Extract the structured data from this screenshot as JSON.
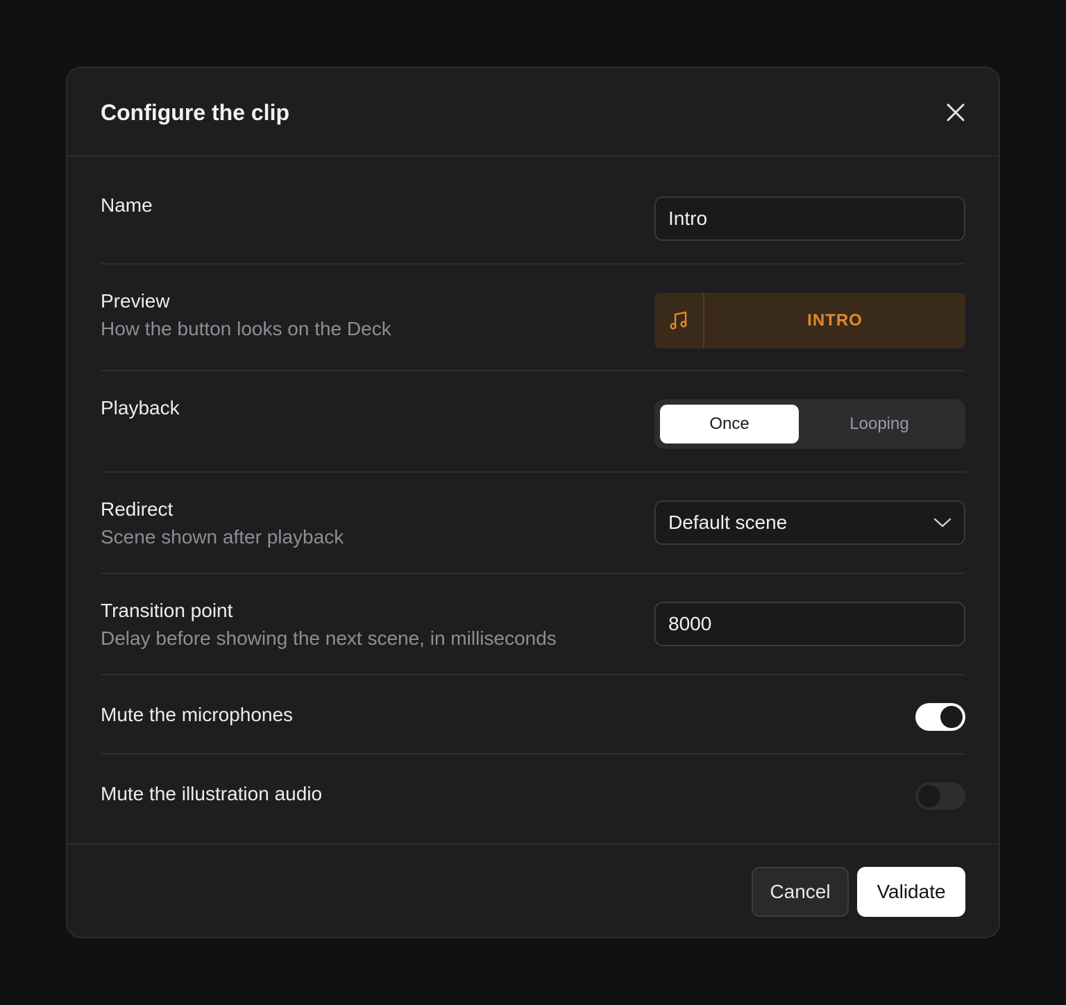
{
  "dialog": {
    "title": "Configure the clip",
    "close_icon": "close-icon"
  },
  "fields": {
    "name": {
      "label": "Name",
      "value": "Intro"
    },
    "preview": {
      "label": "Preview",
      "description": "How the button looks on the Deck",
      "icon": "music-note-icon",
      "button_label": "INTRO",
      "accent_color": "#e08a2a",
      "background_color": "#3a2a1a"
    },
    "playback": {
      "label": "Playback",
      "options": [
        "Once",
        "Looping"
      ],
      "selected": "Once"
    },
    "redirect": {
      "label": "Redirect",
      "description": "Scene shown after playback",
      "value": "Default scene",
      "icon": "chevron-down-icon"
    },
    "transition": {
      "label": "Transition point",
      "description": "Delay before showing the next scene, in milliseconds",
      "value": "8000"
    },
    "mute_microphones": {
      "label": "Mute the microphones",
      "enabled": true
    },
    "mute_illustration": {
      "label": "Mute the illustration audio",
      "enabled": false
    }
  },
  "footer": {
    "cancel_label": "Cancel",
    "validate_label": "Validate"
  }
}
